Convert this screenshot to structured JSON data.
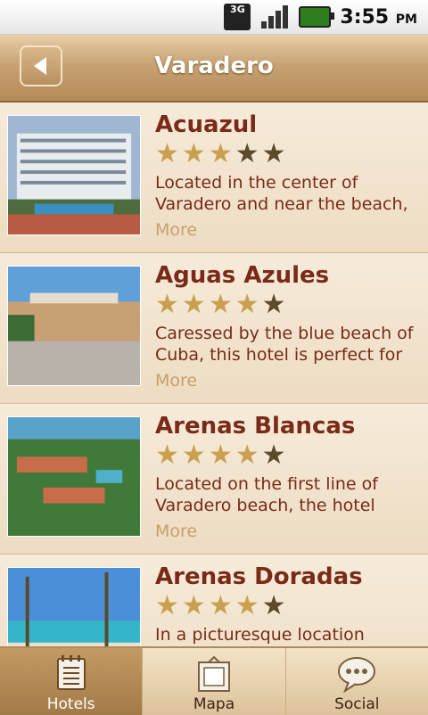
{
  "status_bar": {
    "network": "3G",
    "time": "3:55",
    "ampm": "PM"
  },
  "header": {
    "title": "Varadero"
  },
  "hotels": [
    {
      "name": "Acuazul",
      "rating": 3,
      "max_rating": 5,
      "description": "Located in the center of Varadero and near the beach,",
      "more": "More"
    },
    {
      "name": "Aguas Azules",
      "rating": 4,
      "max_rating": 5,
      "description": "Caressed by the blue beach of Cuba, this hotel is perfect for",
      "more": "More"
    },
    {
      "name": "Arenas Blancas",
      "rating": 4,
      "max_rating": 5,
      "description": "Located on the first line of Varadero beach, the hotel",
      "more": "More"
    },
    {
      "name": "Arenas Doradas",
      "rating": 4,
      "max_rating": 5,
      "description": "In a picturesque location",
      "more": ""
    }
  ],
  "tabs": [
    {
      "label": "Hotels",
      "icon": "notepad-icon",
      "active": true
    },
    {
      "label": "Mapa",
      "icon": "map-icon",
      "active": false
    },
    {
      "label": "Social",
      "icon": "speech-bubble-icon",
      "active": false
    }
  ]
}
